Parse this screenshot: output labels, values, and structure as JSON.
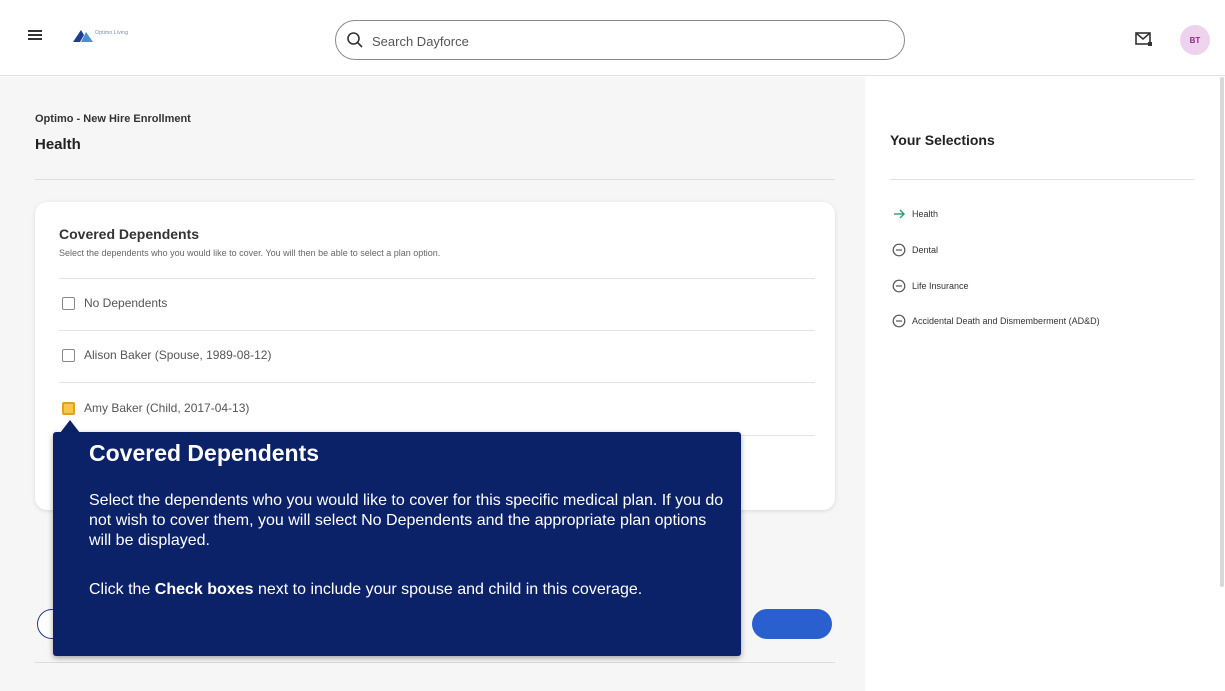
{
  "header": {
    "logo_text": "Optimo Living",
    "search_placeholder": "Search Dayforce",
    "avatar_initials": "BT"
  },
  "main": {
    "breadcrumb": "Optimo - New Hire Enrollment",
    "title": "Health"
  },
  "card": {
    "title": "Covered Dependents",
    "subtitle": "Select the dependents who you would like to cover. You will then be able to select a plan option.",
    "dependents": [
      {
        "label": "No Dependents",
        "checked": false
      },
      {
        "label": "Alison Baker (Spouse, 1989-08-12)",
        "checked": false
      },
      {
        "label": "Amy Baker (Child, 2017-04-13)",
        "checked": false
      }
    ]
  },
  "tooltip": {
    "title": "Covered Dependents",
    "body": "Select the dependents who you would like to cover for this specific medical plan. If you do not wish to cover them, you will select No Dependents and the appropriate plan options will be displayed.",
    "body2_pre": "Click the ",
    "body2_bold": "Check boxes",
    "body2_post": " next to include your spouse and child in this coverage."
  },
  "side": {
    "title": "Your Selections",
    "items": [
      {
        "label": "Health",
        "icon": "arrow-right-icon",
        "current": true
      },
      {
        "label": "Dental",
        "icon": "minus-circle-icon",
        "current": false
      },
      {
        "label": "Life Insurance",
        "icon": "minus-circle-icon",
        "current": false
      },
      {
        "label": "Accidental Death and Dismemberment (AD&D)",
        "icon": "minus-circle-icon",
        "current": false
      }
    ]
  },
  "colors": {
    "tooltip_bg": "#0c2268",
    "avatar_bg": "#efd3ee",
    "avatar_text": "#8f2a8a",
    "highlight_checkbox": "#f6c84a",
    "current_item_arrow": "#2a9d6b"
  }
}
